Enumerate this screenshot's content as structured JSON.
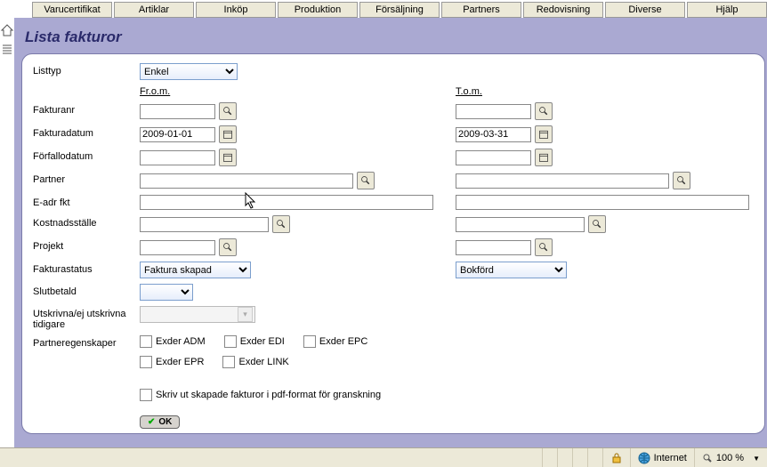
{
  "tabs": [
    "Varucertifikat",
    "Artiklar",
    "Inköp",
    "Produktion",
    "Försäljning",
    "Partners",
    "Redovisning",
    "Diverse",
    "Hjälp"
  ],
  "page_title": "Lista fakturor",
  "labels": {
    "listtyp": "Listtyp",
    "from": "Fr.o.m.",
    "tom": "T.o.m.",
    "fakturanr": "Fakturanr",
    "fakturadatum": "Fakturadatum",
    "forfallodatum": "Förfallodatum",
    "partner": "Partner",
    "eadr": "E-adr fkt",
    "kostnadsstalle": "Kostnadsställe",
    "projekt": "Projekt",
    "fakturastatus": "Fakturastatus",
    "slutbetald": "Slutbetald",
    "utskrivna": "Utskrivna/ej utskrivna tidigare",
    "partneregenskaper": "Partneregenskaper"
  },
  "values": {
    "listtyp_selected": "Enkel",
    "fakturadatum_from": "2009-01-01",
    "fakturadatum_to": "2009-03-31",
    "fakturastatus_from": "Faktura skapad",
    "fakturastatus_to": "Bokförd"
  },
  "checkboxes": {
    "exder_adm": "Exder ADM",
    "exder_edi": "Exder EDI",
    "exder_epc": "Exder EPC",
    "exder_epr": "Exder EPR",
    "exder_link": "Exder LINK",
    "pdf_print": "Skriv ut skapade fakturor i pdf-format för granskning"
  },
  "ok_label": "OK",
  "status": {
    "zone": "Internet",
    "zoom": "100 %"
  }
}
